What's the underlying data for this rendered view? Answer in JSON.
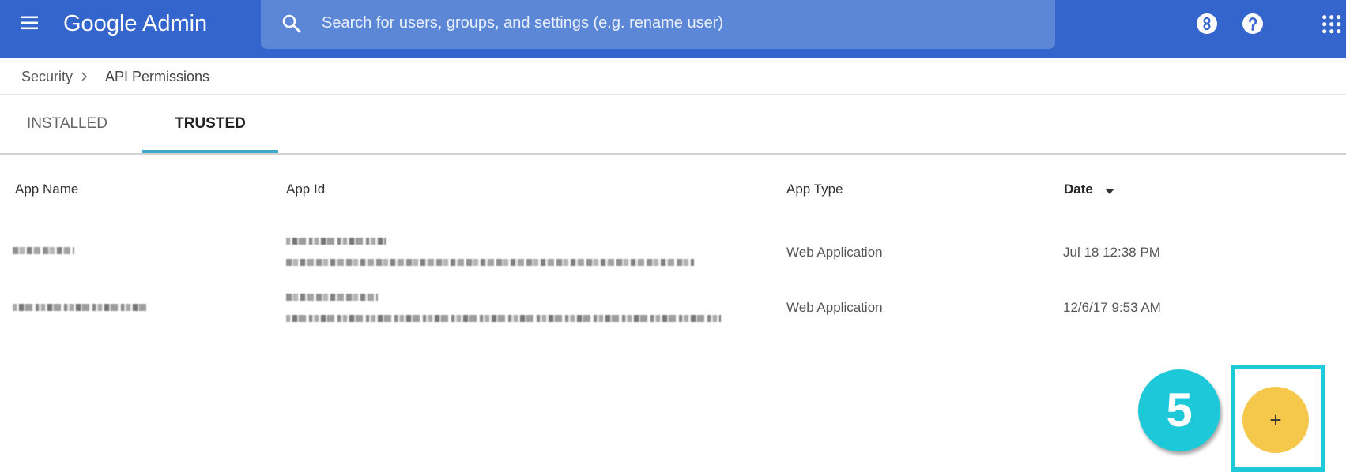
{
  "header": {
    "menu_icon": "hamburger-menu-icon",
    "app_title": "Google Admin",
    "search": {
      "icon": "search-icon",
      "placeholder": "Search for users, groups, and settings (e.g. rename user)",
      "value": ""
    },
    "right_icons": [
      "hourglass-icon",
      "help-icon",
      "apps-grid-icon"
    ]
  },
  "breadcrumb": {
    "items": [
      "Security",
      "API Permissions"
    ],
    "separator_icon": "chevron-right-icon"
  },
  "tabs": [
    {
      "label": "INSTALLED",
      "active": false
    },
    {
      "label": "TRUSTED",
      "active": true
    }
  ],
  "table": {
    "columns": [
      "App Name",
      "App Id",
      "App Type",
      "Date"
    ],
    "sort_icon": "sort-descending-icon",
    "rows": [
      {
        "app_type": "Web Application",
        "date": "Jul 18 12:38 PM"
      },
      {
        "app_type": "Web Application",
        "date": "12/6/17 9:53 AM"
      }
    ]
  },
  "fab": {
    "label": "+",
    "icon": "add-icon"
  },
  "annotation": {
    "step_number": "5"
  },
  "colors": {
    "header": "#3465cc",
    "search_box": "#5c87d7",
    "tab_indicator": "#3fa8c6",
    "fab": "#f5c74a",
    "annotation": "#1dc8d8"
  }
}
